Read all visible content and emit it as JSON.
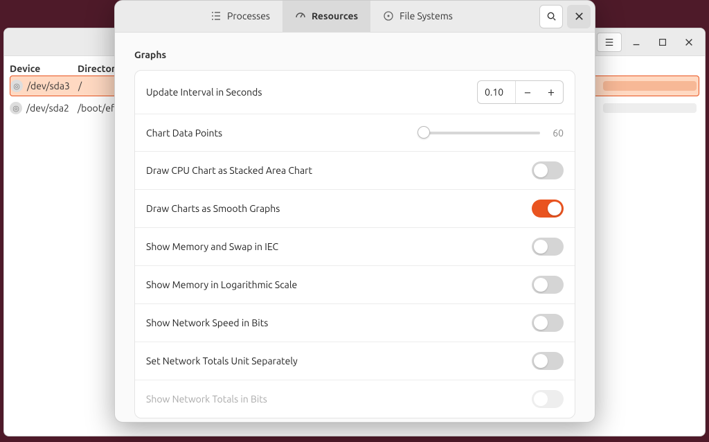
{
  "bg_window": {
    "columns": {
      "device": "Device",
      "directory": "Directory"
    },
    "rows": [
      {
        "device": "/dev/sda3",
        "directory": "/"
      },
      {
        "device": "/dev/sda2",
        "directory": "/boot/efi"
      }
    ]
  },
  "dialog": {
    "tabs": {
      "processes": "Processes",
      "resources": "Resources",
      "file_systems": "File Systems"
    },
    "section_title": "Graphs",
    "settings": {
      "update_interval": {
        "label": "Update Interval in Seconds",
        "value": "0.10"
      },
      "chart_data_points": {
        "label": "Chart Data Points",
        "value": "60"
      },
      "cpu_stacked": {
        "label": "Draw CPU Chart as Stacked Area Chart",
        "on": false
      },
      "smooth_graphs": {
        "label": "Draw Charts as Smooth Graphs",
        "on": true
      },
      "mem_iec": {
        "label": "Show Memory and Swap in IEC",
        "on": false
      },
      "mem_log": {
        "label": "Show Memory in Logarithmic Scale",
        "on": false
      },
      "net_bits": {
        "label": "Show Network Speed in Bits",
        "on": false
      },
      "net_totals_separate": {
        "label": "Set Network Totals Unit Separately",
        "on": false
      },
      "net_totals_bits": {
        "label": "Show Network Totals in Bits",
        "disabled": true
      }
    }
  }
}
